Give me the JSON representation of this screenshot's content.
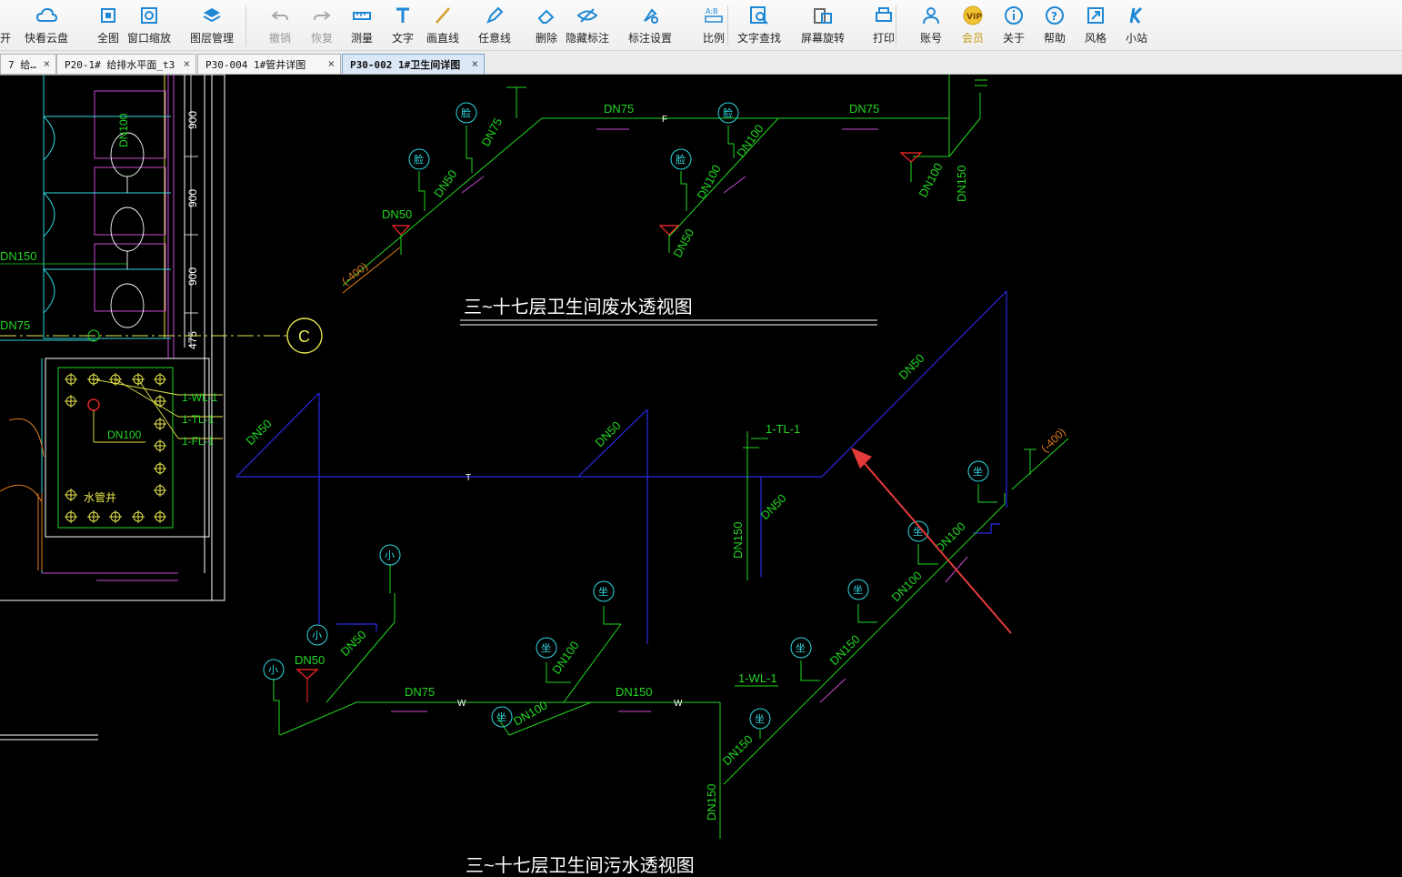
{
  "toolbar": {
    "items": [
      {
        "label": "开",
        "icon": "open-icon"
      },
      {
        "label": "快看云盘",
        "icon": "cloud-icon"
      },
      {
        "label": "全图",
        "icon": "fit-view-icon"
      },
      {
        "label": "窗口缩放",
        "icon": "zoom-window-icon"
      },
      {
        "label": "图层管理",
        "icon": "layers-icon"
      },
      {
        "label": "撤销",
        "icon": "undo-icon"
      },
      {
        "label": "恢复",
        "icon": "redo-icon"
      },
      {
        "label": "测量",
        "icon": "ruler-icon"
      },
      {
        "label": "文字",
        "icon": "text-icon"
      },
      {
        "label": "画直线",
        "icon": "line-icon"
      },
      {
        "label": "任意线",
        "icon": "pen-icon"
      },
      {
        "label": "删除",
        "icon": "eraser-icon"
      },
      {
        "label": "隐藏标注",
        "icon": "eye-hide-icon"
      },
      {
        "label": "标注设置",
        "icon": "annotation-settings-icon"
      },
      {
        "label": "比例",
        "icon": "scale-icon"
      },
      {
        "label": "文字查找",
        "icon": "text-search-icon"
      },
      {
        "label": "屏幕旋转",
        "icon": "rotate-screen-icon"
      },
      {
        "label": "打印",
        "icon": "printer-icon"
      },
      {
        "label": "账号",
        "icon": "user-icon"
      },
      {
        "label": "会员",
        "icon": "vip-icon"
      },
      {
        "label": "关于",
        "icon": "info-icon"
      },
      {
        "label": "帮助",
        "icon": "help-icon"
      },
      {
        "label": "风格",
        "icon": "style-icon"
      },
      {
        "label": "小站",
        "icon": "k-logo-icon"
      }
    ]
  },
  "tabs": [
    {
      "label": "7 给…",
      "close": "×"
    },
    {
      "label": "P20-1# 给排水平面_t3",
      "close": "×"
    },
    {
      "label": "P30-004 1#管井详图",
      "close": "×"
    },
    {
      "label": "P30-002 1#卫生间详图",
      "close": "×"
    }
  ],
  "drawing": {
    "plan_labels": {
      "dn100": "DN100",
      "dn150": "DN150",
      "dn75": "DN75",
      "dim_900": "900",
      "dim_475": "475",
      "axis_c": "C",
      "wl": "1-WL-1",
      "tl": "1-TL-1",
      "fl": "1-FL-1",
      "shaft_dn100": "DN100",
      "shaft_name": "水管井"
    },
    "waste": {
      "title": "三~十七层卫生间废水透视图",
      "dn75_a": "DN75",
      "dn75_b": "DN75",
      "dn75_c": "DN75",
      "dn50_a": "DN50",
      "dn50_b": "DN50",
      "dn100_a": "DN100",
      "dn100_b": "DN100",
      "dn100_c": "DN100",
      "dn50_c": "DN50",
      "dn150": "DN150",
      "level": "(-400)",
      "fixture": "脸",
      "f_mark": "F"
    },
    "sewage": {
      "title": "三~十七层卫生间污水透视图",
      "dn50_a": "DN50",
      "dn50_b": "DN50",
      "dn50_c": "DN50",
      "dn50_d": "DN50",
      "dn50_e": "DN50",
      "dn50_f": "DN50",
      "dn150_a": "DN150",
      "dn75": "DN75",
      "dn150_b": "DN150",
      "dn100_a": "DN100",
      "dn100_b": "DN100",
      "dn100_c": "DN100",
      "dn100_d": "DN100",
      "dn150_c": "DN150",
      "dn150_d": "DN150",
      "dn150_e": "DN150",
      "tl": "1-TL-1",
      "wl": "1-WL-1",
      "level": "(-400)",
      "t_mark": "T",
      "w_mark": "W",
      "fixture_small": "小",
      "fixture_squat": "坐"
    }
  },
  "colors": {
    "green": "#22d622",
    "yellow": "#e6e64c",
    "cyan": "#2fd8e0",
    "blue": "#2a2ae6",
    "magenta": "#c94ad6",
    "red": "#ff2a2a",
    "white": "#ffffff",
    "arrow": "#e53b3b"
  }
}
